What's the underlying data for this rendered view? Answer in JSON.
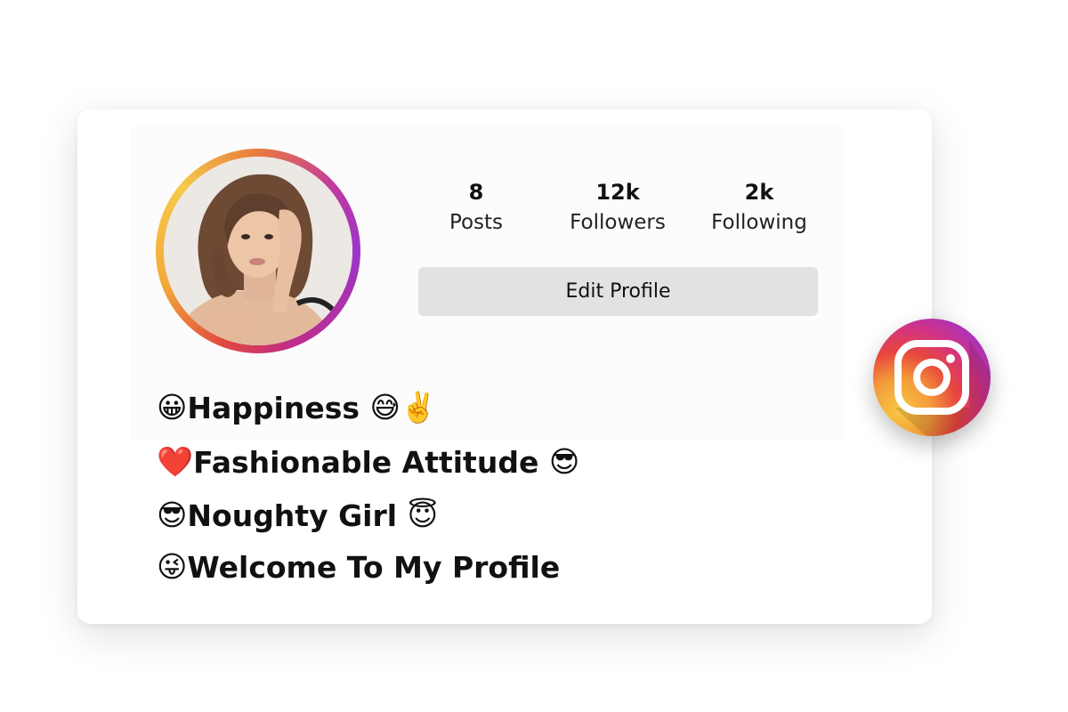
{
  "profile": {
    "stats": [
      {
        "value": "8",
        "label": "Posts"
      },
      {
        "value": "12k",
        "label": "Followers"
      },
      {
        "value": "2k",
        "label": "Following"
      }
    ],
    "edit_button_label": "Edit Profile"
  },
  "bio": {
    "lines": [
      {
        "prefix_emoji": "😀",
        "text": "Happiness",
        "suffix_emoji": "😅✌️"
      },
      {
        "prefix_emoji": "❤️",
        "text": "Fashionable Attitude",
        "suffix_emoji": "😎"
      },
      {
        "prefix_emoji": "😎",
        "text": " Noughty Girl",
        "suffix_emoji": "😇"
      },
      {
        "prefix_emoji": "😜",
        "text": "Welcome To My Profile",
        "suffix_emoji": ""
      }
    ]
  },
  "brand": {
    "icon": "instagram-icon",
    "gradient": [
      "#f8c843",
      "#f39a3a",
      "#e8463d",
      "#d23286",
      "#a234c4"
    ],
    "ring_colors": [
      "#9b35c9",
      "#f6c94a"
    ]
  }
}
